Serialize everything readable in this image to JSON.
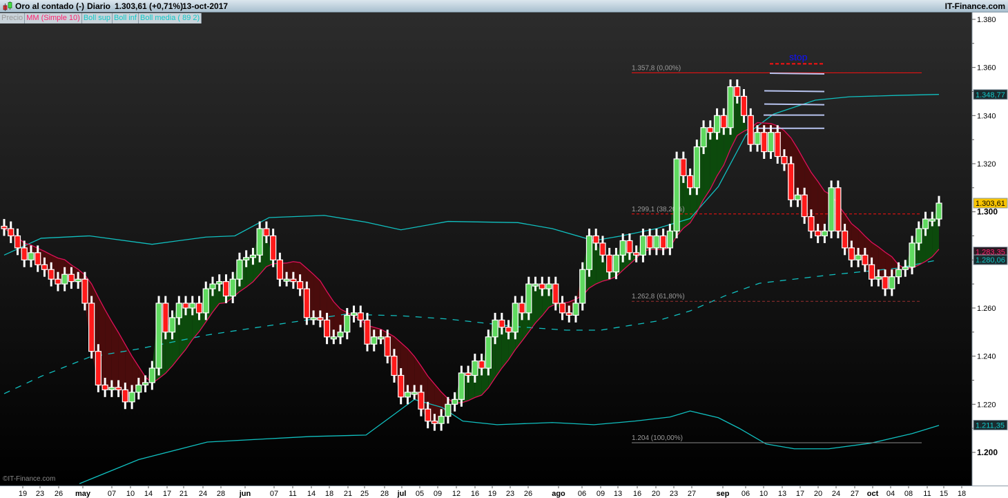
{
  "header": {
    "instrument": "Oro al contado (-)",
    "period": "Diario",
    "price_change": "1.303,61 (+0,71%)",
    "date": "13-oct-2017",
    "brand": "IT-Finance.com"
  },
  "legend": {
    "items": [
      {
        "label": "Precio",
        "color": "#9a9a9a"
      },
      {
        "label": "MM (Simple 10)",
        "color": "#ff1f6e"
      },
      {
        "label": "Boll sup",
        "color": "#10c8c8"
      },
      {
        "label": "Boll inf",
        "color": "#10c8c8"
      },
      {
        "label": "Boll media ( 89 2)",
        "color": "#10c8c8"
      }
    ]
  },
  "copyright": "©IT-Finance.com",
  "colors": {
    "up": "#5fd95f",
    "down": "#ff1a1a",
    "mm": "#e0105a",
    "boll": "#10c0c0",
    "fill_up": "#0c4a0c",
    "fill_down": "#4a0c0c"
  },
  "chart_data": {
    "type": "candlestick",
    "ylim": [
      1.188,
      1.383
    ],
    "y_ticks": [
      "1.380",
      "1.360",
      "1.340",
      "1.320",
      "1.300",
      "1.280",
      "1.260",
      "1.240",
      "1.220",
      "1.200"
    ],
    "y_tick_values": [
      1.38,
      1.36,
      1.34,
      1.32,
      1.3,
      1.28,
      1.26,
      1.24,
      1.22,
      1.2
    ],
    "x_ticks": [
      "19",
      "23",
      "26",
      "may",
      "07",
      "10",
      "14",
      "17",
      "21",
      "24",
      "28",
      "jun",
      "07",
      "11",
      "14",
      "18",
      "21",
      "25",
      "28",
      "jul",
      "05",
      "09",
      "12",
      "16",
      "19",
      "23",
      "26",
      "ago",
      "06",
      "09",
      "13",
      "16",
      "20",
      "23",
      "27",
      "sep",
      "06",
      "10",
      "13",
      "17",
      "20",
      "24",
      "27",
      "oct",
      "04",
      "08",
      "11",
      "15",
      "18"
    ],
    "close": [
      1.293,
      1.29,
      1.285,
      1.28,
      1.283,
      1.278,
      1.276,
      1.272,
      1.27,
      1.274,
      1.271,
      1.272,
      1.262,
      1.242,
      1.228,
      1.226,
      1.227,
      1.226,
      1.221,
      1.225,
      1.228,
      1.229,
      1.235,
      1.262,
      1.25,
      1.256,
      1.262,
      1.26,
      1.262,
      1.258,
      1.268,
      1.27,
      1.271,
      1.265,
      1.272,
      1.28,
      1.281,
      1.282,
      1.293,
      1.29,
      1.28,
      1.272,
      1.272,
      1.271,
      1.268,
      1.256,
      1.256,
      1.255,
      1.248,
      1.248,
      1.25,
      1.257,
      1.258,
      1.255,
      1.245,
      1.248,
      1.248,
      1.24,
      1.232,
      1.223,
      1.225,
      1.225,
      1.218,
      1.213,
      1.212,
      1.215,
      1.22,
      1.222,
      1.233,
      1.232,
      1.238,
      1.235,
      1.248,
      1.255,
      1.252,
      1.25,
      1.262,
      1.258,
      1.27,
      1.27,
      1.268,
      1.27,
      1.262,
      1.258,
      1.257,
      1.262,
      1.276,
      1.29,
      1.287,
      1.282,
      1.275,
      1.282,
      1.288,
      1.283,
      1.282,
      1.29,
      1.285,
      1.29,
      1.285,
      1.292,
      1.322,
      1.315,
      1.31,
      1.327,
      1.335,
      1.333,
      1.34,
      1.335,
      1.352,
      1.348,
      1.34,
      1.328,
      1.333,
      1.325,
      1.333,
      1.323,
      1.32,
      1.305,
      1.307,
      1.298,
      1.292,
      1.29,
      1.292,
      1.31,
      1.292,
      1.285,
      1.28,
      1.282,
      1.278,
      1.272,
      1.273,
      1.268,
      1.273,
      1.276,
      1.277,
      1.287,
      1.293,
      1.297,
      1.297,
      1.3036
    ],
    "boll_sup": [
      [
        0,
        1.282
      ],
      [
        5.5,
        1.289
      ],
      [
        12.7,
        1.29
      ],
      [
        22,
        1.2865
      ],
      [
        30,
        1.2895
      ],
      [
        34.3,
        1.29
      ],
      [
        39.4,
        1.2976
      ],
      [
        47.6,
        1.2985
      ],
      [
        53.8,
        1.2957
      ],
      [
        59,
        1.2925
      ],
      [
        66,
        1.296
      ],
      [
        76.4,
        1.2955
      ],
      [
        81.5,
        1.293
      ],
      [
        87.7,
        1.288
      ],
      [
        91.8,
        1.29
      ],
      [
        97,
        1.293
      ],
      [
        102,
        1.2972
      ],
      [
        106.2,
        1.3105
      ],
      [
        110.3,
        1.332
      ],
      [
        114.4,
        1.3406
      ],
      [
        120.6,
        1.3464
      ],
      [
        125.7,
        1.3478
      ],
      [
        132.9,
        1.3484
      ],
      [
        139,
        1.3488
      ]
    ],
    "boll_inf": [
      [
        11.2,
        1.187
      ],
      [
        20,
        1.197
      ],
      [
        30.2,
        1.2043
      ],
      [
        45.6,
        1.2066
      ],
      [
        53.8,
        1.2072
      ],
      [
        58,
        1.2158
      ],
      [
        61,
        1.222
      ],
      [
        65.1,
        1.2187
      ],
      [
        68.2,
        1.213
      ],
      [
        73.3,
        1.2115
      ],
      [
        81.5,
        1.2124
      ],
      [
        87.7,
        1.2115
      ],
      [
        93.8,
        1.213
      ],
      [
        99,
        1.2147
      ],
      [
        102,
        1.2172
      ],
      [
        106.2,
        1.2144
      ],
      [
        109.3,
        1.21
      ],
      [
        113.3,
        1.2035
      ],
      [
        117.5,
        1.2015
      ],
      [
        122.6,
        1.2015
      ],
      [
        128.8,
        1.2038
      ],
      [
        135,
        1.2078
      ],
      [
        139,
        1.2112
      ]
    ],
    "boll_media": [
      [
        0,
        1.2244
      ],
      [
        5.5,
        1.2316
      ],
      [
        12.7,
        1.2396
      ],
      [
        20,
        1.243
      ],
      [
        30.2,
        1.2488
      ],
      [
        40.4,
        1.2531
      ],
      [
        50.7,
        1.2574
      ],
      [
        58.9,
        1.2568
      ],
      [
        66.1,
        1.2554
      ],
      [
        76.4,
        1.2522
      ],
      [
        83.6,
        1.2508
      ],
      [
        88.7,
        1.2508
      ],
      [
        96.9,
        1.2545
      ],
      [
        102,
        1.2588
      ],
      [
        107.2,
        1.2651
      ],
      [
        112.3,
        1.2703
      ],
      [
        122.6,
        1.2737
      ],
      [
        132.9,
        1.2766
      ],
      [
        139,
        1.2801
      ]
    ],
    "fibonacci": [
      {
        "label": "1.357,8 (0,00%)",
        "value": 1.3578,
        "color": "#ff1010",
        "style": "solid"
      },
      {
        "label": "1.299,1 (38,20%)",
        "value": 1.2991,
        "color": "#ff1010",
        "style": "dashed"
      },
      {
        "label": "1.262,8 (61,80%)",
        "value": 1.2628,
        "color": "#9a3030",
        "style": "dashed"
      },
      {
        "label": "1.204 (100,00%)",
        "value": 1.204,
        "color": "#8a8a8a",
        "style": "solid"
      }
    ],
    "stop": {
      "label": "stop",
      "value": 1.3615,
      "color": "#1010ff"
    },
    "target_lines": [
      1.3576,
      1.3503,
      1.3448,
      1.3402,
      1.3347
    ],
    "price_tags": [
      {
        "label": "1.348,77",
        "value": 1.34877,
        "color": "#10c8c8",
        "bg": "#1a2a2e"
      },
      {
        "label": "1.303,61",
        "value": 1.30361,
        "color": "#000000",
        "bg": "#f8c400"
      },
      {
        "label": "1.283,35",
        "value": 1.28335,
        "color": "#ff1f6e",
        "bg": "#2a1a22"
      },
      {
        "label": "1.280,06",
        "value": 1.28006,
        "color": "#10c8c8",
        "bg": "#1a2a2e"
      },
      {
        "label": "1.211,35",
        "value": 1.21135,
        "color": "#10c8c8",
        "bg": "#1a2a2e"
      }
    ]
  }
}
